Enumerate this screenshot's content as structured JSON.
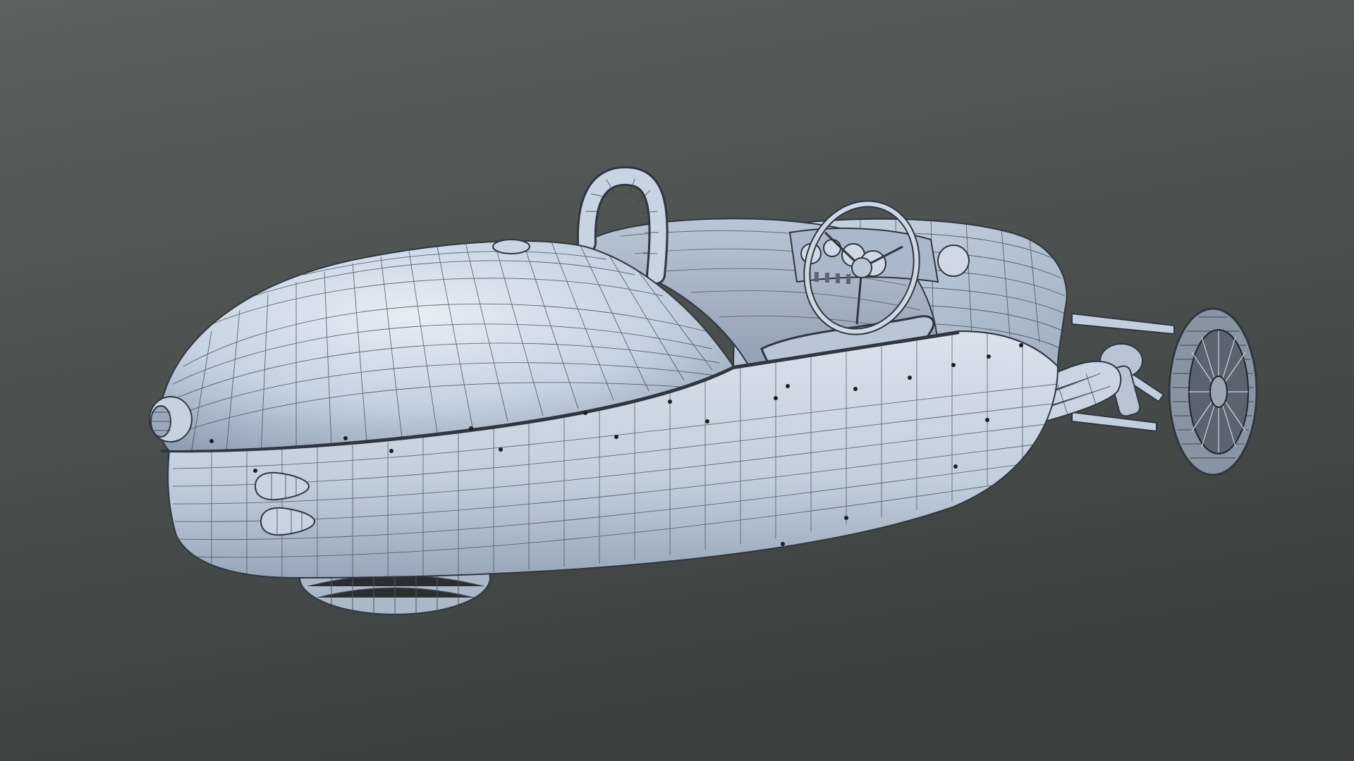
{
  "viewport": {
    "background_top": "#5b5f5d",
    "background_bottom": "#3e4240"
  },
  "model": {
    "subject": "three-wheeler-roadster-wireframe",
    "shading": {
      "body_fill_light": "#d7e1ee",
      "body_fill_mid": "#b4c3d4",
      "body_fill_dark": "#8c9cae",
      "wire_color": "#2f3640",
      "rivet_color": "#1b1f25",
      "tire_color": "#6f7a86"
    }
  }
}
